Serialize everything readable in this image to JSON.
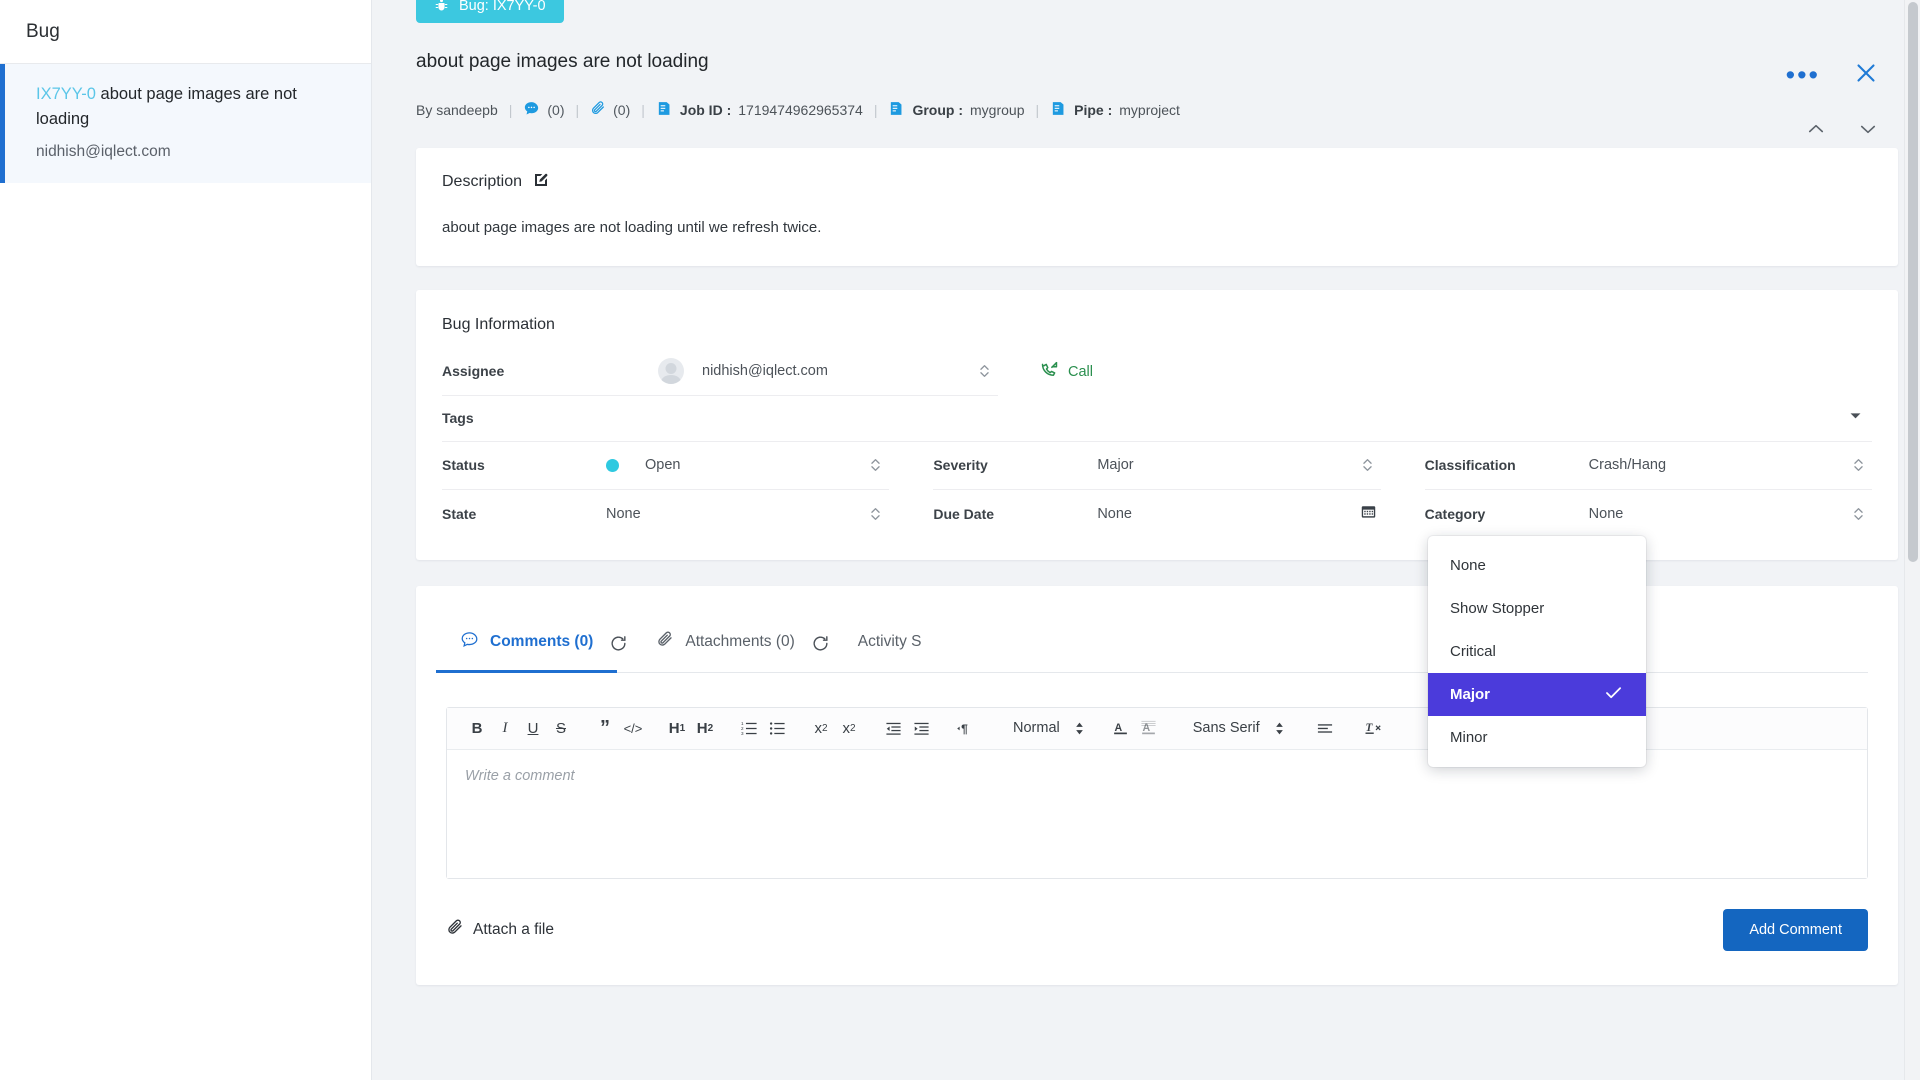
{
  "list_pane": {
    "header_title": "Bug",
    "items": [
      {
        "key": "IX7YY-0",
        "title": "about page images are not loading",
        "subtitle": "nidhish@iqlect.com"
      }
    ]
  },
  "detail": {
    "chip_label": "Bug: IX7YY-0",
    "chip_color": "#3cc8e0",
    "title": "about page images are not loading",
    "meta": {
      "author": "By sandeepb",
      "comments_count": "(0)",
      "attachments_count": "(0)",
      "job_id_label": "Job ID :",
      "job_id_value": "1719474962965374",
      "group_label": "Group :",
      "group_value": "mygroup",
      "pipe_label": "Pipe :",
      "pipe_value": "myproject",
      "separator": "|"
    },
    "description": {
      "label": "Description",
      "body": "about page images are not loading until we refresh twice."
    },
    "bug_information": {
      "title": "Bug Information",
      "assignee": {
        "label": "Assignee",
        "value": "nidhish@iqlect.com"
      },
      "call_label": "Call",
      "tags": {
        "label": "Tags",
        "value": ""
      },
      "status": {
        "label": "Status",
        "value": "Open",
        "dot_color": "#2fc9e0"
      },
      "state": {
        "label": "State",
        "value": "None"
      },
      "severity": {
        "label": "Severity",
        "value": "Major"
      },
      "due_date": {
        "label": "Due Date",
        "value": "None"
      },
      "classification": {
        "label": "Classification",
        "value": "Crash/Hang"
      },
      "category": {
        "label": "Category",
        "value": "None"
      }
    },
    "severity_menu": {
      "selected": "Major",
      "highlight_color": "#4b3bdb",
      "options": [
        {
          "label": "None"
        },
        {
          "label": "Show Stopper"
        },
        {
          "label": "Critical"
        },
        {
          "label": "Major"
        },
        {
          "label": "Minor"
        }
      ]
    },
    "comment_section": {
      "tabs": [
        {
          "label": "Comments (0)",
          "active": true
        },
        {
          "label": "Attachments (0)",
          "active": false
        },
        {
          "label": "Activity S",
          "active": false
        }
      ],
      "toolbar": {
        "bold": "B",
        "italic": "I",
        "underline": "U",
        "strike": "S",
        "blockquote": "”",
        "code": "</>",
        "h1": "H",
        "h1_sub": "1",
        "h2": "H",
        "h2_sub": "2",
        "subscript": "x",
        "subscript_sub": "2",
        "superscript": "x",
        "superscript_sup": "2",
        "heading_select": "Normal",
        "font_select": "Sans Serif"
      },
      "editor_placeholder": "Write a comment",
      "attach_label": "Attach a file",
      "add_comment_label": "Add Comment",
      "add_comment_color": "#1466c0"
    }
  }
}
